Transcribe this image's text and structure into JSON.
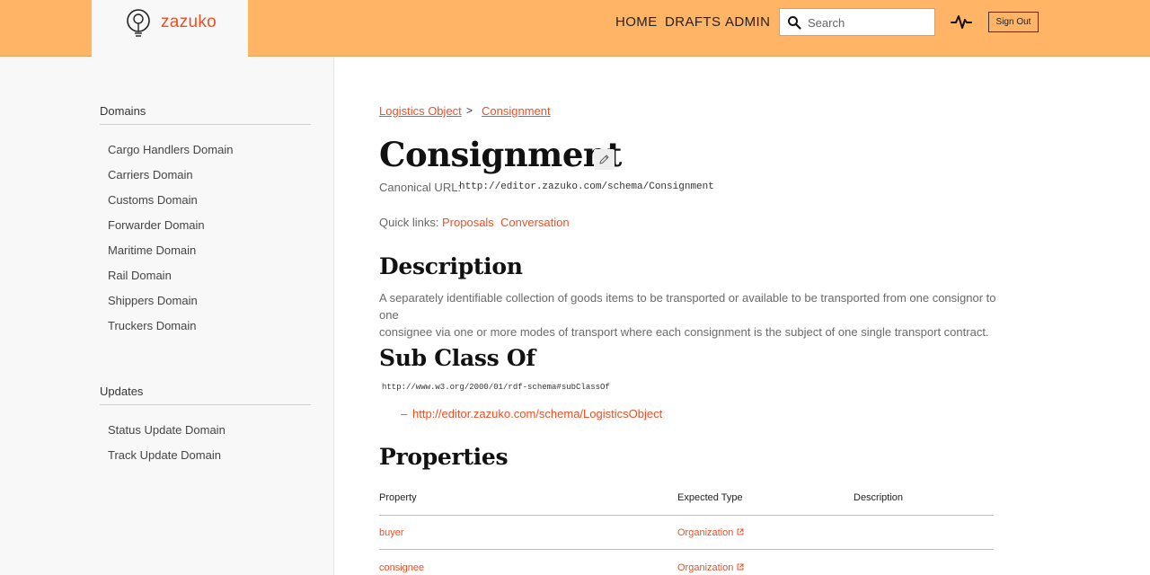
{
  "brand": {
    "name": "zazuko",
    "accent": "#f04e23",
    "header_bg": "#ffb466"
  },
  "header": {
    "nav": [
      "HOME",
      "DRAFTS",
      "ADMIN"
    ],
    "search_placeholder": "Search",
    "search_icon": "search-icon",
    "activity_icon": "pulse-icon",
    "signout_label": "Sign Out"
  },
  "sidebar": {
    "sections": [
      {
        "title": "Domains",
        "items": [
          "Cargo Handlers Domain",
          "Carriers Domain",
          "Customs Domain",
          "Forwarder Domain",
          "Maritime Domain",
          "Rail Domain",
          "Shippers Domain",
          "Truckers Domain"
        ]
      },
      {
        "title": "Updates",
        "items": [
          "Status Update Domain",
          "Track Update Domain"
        ]
      }
    ]
  },
  "main": {
    "breadcrumb": [
      "Logistics Object",
      "Consignment"
    ],
    "breadcrumb_sep": ">",
    "title": "Consignment",
    "edit_icon": "pencil-icon",
    "canonical_label": "Canonical URL:",
    "canonical_url": "http://editor.zazuko.com/schema/Consignment",
    "quick_links_label": "Quick links:",
    "quick_links": [
      "Proposals",
      "Conversation"
    ],
    "description_heading": "Description",
    "description_lines": [
      "A separately identifiable collection of goods items to be transported or available to be transported from one consignor to one",
      "consignee via one or more modes of transport where each consignment is the subject of one single transport contract."
    ],
    "subclass_heading": "Sub Class Of",
    "subclass_predicate": "http://www.w3.org/2000/01/rdf-schema#subClassOf",
    "subclass_dash": "–",
    "subclass_value": "http://editor.zazuko.com/schema/LogisticsObject",
    "properties_heading": "Properties",
    "properties_columns": [
      "Property",
      "Expected Type",
      "Description"
    ],
    "properties_rows": [
      {
        "property": "buyer",
        "type": "Organization",
        "description": ""
      },
      {
        "property": "consignee",
        "type": "Organization",
        "description": ""
      }
    ]
  }
}
